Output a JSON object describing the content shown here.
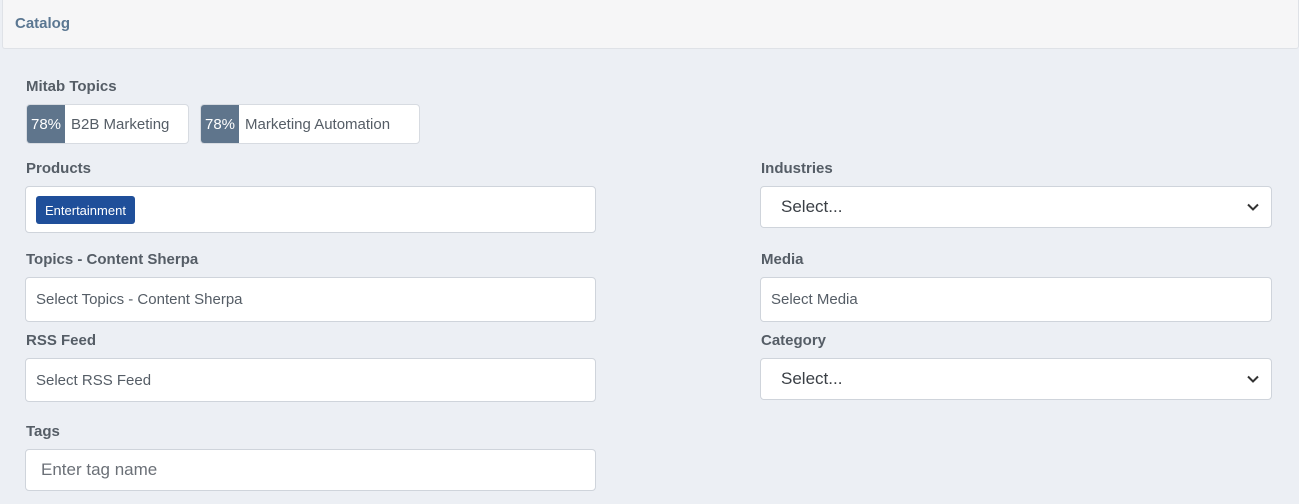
{
  "header": {
    "title": "Catalog"
  },
  "mitab_topics": {
    "label": "Mitab Topics",
    "chips": [
      {
        "percent": "78%",
        "label": "B2B Marketing"
      },
      {
        "percent": "78%",
        "label": "Marketing Automation"
      }
    ]
  },
  "products": {
    "label": "Products",
    "tags": [
      "Entertainment"
    ]
  },
  "industries": {
    "label": "Industries",
    "selected": "Select..."
  },
  "topics_content_sherpa": {
    "label": "Topics - Content Sherpa",
    "placeholder": "Select Topics - Content Sherpa"
  },
  "media": {
    "label": "Media",
    "placeholder": "Select Media"
  },
  "rss_feed": {
    "label": "RSS Feed",
    "placeholder": "Select RSS Feed"
  },
  "category": {
    "label": "Category",
    "selected": "Select..."
  },
  "tags": {
    "label": "Tags",
    "placeholder": "Enter tag name"
  },
  "icons": {
    "select_arrow": "chevron-down-icon"
  },
  "colors": {
    "chip_percent_bg": "#5f758c",
    "product_tag_bg": "#1f4f9a",
    "title_color": "#5b7792"
  }
}
